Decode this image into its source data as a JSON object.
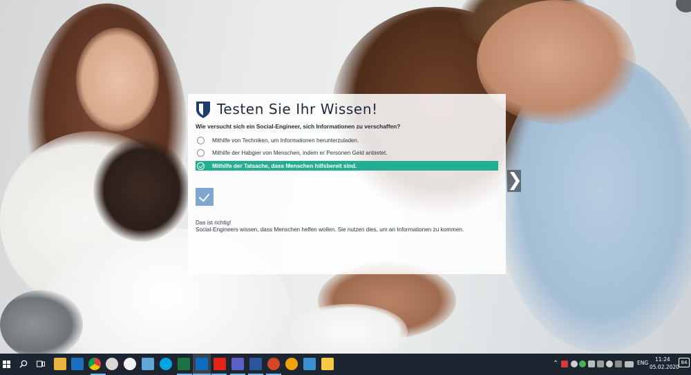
{
  "quiz": {
    "title": "Testen Sie Ihr Wissen!",
    "question": "Wie versucht sich ein Social-Engineer, sich Informationen zu verschaffen?",
    "answers": [
      {
        "label": "Mithilfe von Techniken, um Informationen herunterzuladen.",
        "selected": false
      },
      {
        "label": "Mithilfe der Habgier von Menschen, indem er Personen Geld anbietet.",
        "selected": false
      },
      {
        "label": "Mithilfe der Tatsache, dass Menschen hilfsbereit sind.",
        "selected": true
      }
    ],
    "submit_icon": "checkmark-icon",
    "feedback_title": "Das ist richtig!",
    "feedback_text": "Social-Engineers wissen, dass Menschen helfen wollen. Sie nutzen dies, um an Informationen zu kommen.",
    "accent_color": "#25ad93",
    "button_color": "#7ea6cf",
    "logo_icon": "shield-icon"
  },
  "navigation": {
    "next_icon": "chevron-right-icon",
    "next_glyph": "❯"
  },
  "taskbar": {
    "background": "#1d2530",
    "apps": [
      "windows-start-icon",
      "search-icon",
      "task-view-icon",
      "file-explorer-icon",
      "store-icon",
      "chrome-icon",
      "app-icon",
      "photos-icon",
      "notepad-icon",
      "skype-icon",
      "excel-icon",
      "outlook-icon",
      "acrobat-icon",
      "teams-icon",
      "word-icon",
      "powerpoint-icon",
      "app-icon",
      "remote-desktop-icon",
      "notes-icon"
    ],
    "tray": {
      "language": "ENG",
      "time": "11:24",
      "date": "05.02.2020",
      "notification_count": "84",
      "chevron_glyph": "⌃"
    }
  }
}
